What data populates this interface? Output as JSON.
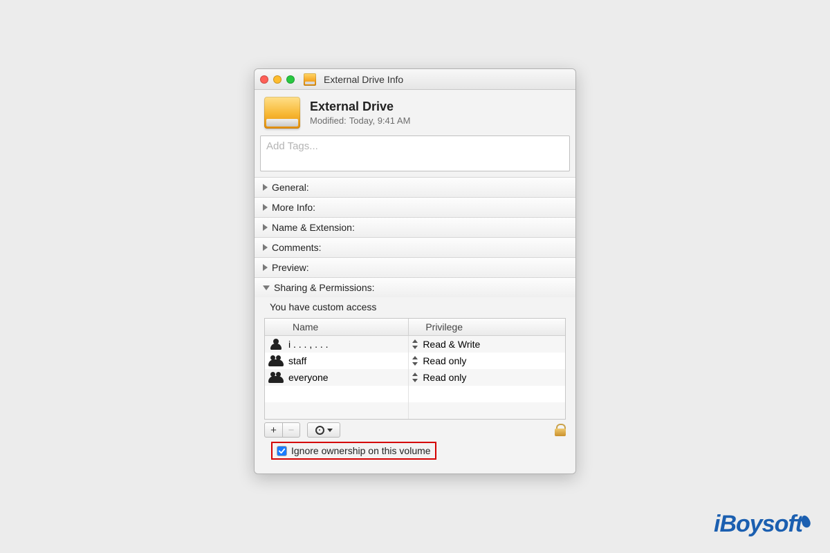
{
  "window": {
    "title": "External Drive Info"
  },
  "header": {
    "name": "External Drive",
    "modified_label": "Modified:",
    "modified_value": "Today, 9:41 AM"
  },
  "tags": {
    "placeholder": "Add Tags..."
  },
  "sections": {
    "general": "General:",
    "more_info": "More Info:",
    "name_ext": "Name & Extension:",
    "comments": "Comments:",
    "preview": "Preview:",
    "sharing": "Sharing & Permissions:"
  },
  "permissions": {
    "note": "You have custom access",
    "columns": {
      "name": "Name",
      "privilege": "Privilege"
    },
    "rows": [
      {
        "name": "i . . . , . . .",
        "privilege": "Read & Write",
        "icon": "user"
      },
      {
        "name": "staff",
        "privilege": "Read only",
        "icon": "group"
      },
      {
        "name": "everyone",
        "privilege": "Read only",
        "icon": "group"
      }
    ],
    "ignore_label": "Ignore ownership on this volume"
  },
  "watermark": "iBoysoft"
}
